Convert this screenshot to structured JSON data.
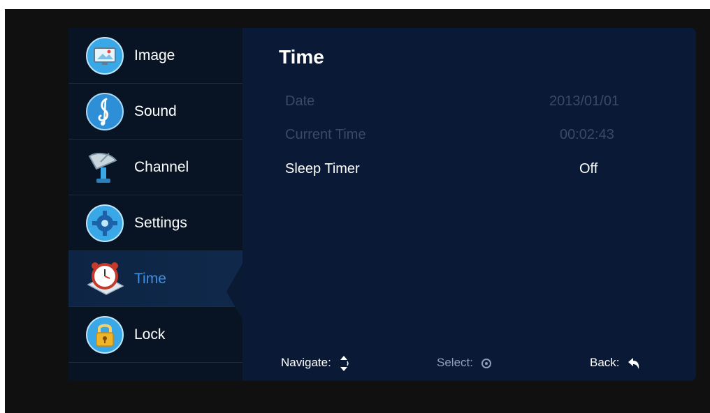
{
  "sidebar": {
    "items": [
      {
        "label": "Image",
        "icon": "image-icon"
      },
      {
        "label": "Sound",
        "icon": "music-note-icon"
      },
      {
        "label": "Channel",
        "icon": "satellite-dish-icon"
      },
      {
        "label": "Settings",
        "icon": "gear-icon"
      },
      {
        "label": "Time",
        "icon": "alarm-clock-icon",
        "active": true
      },
      {
        "label": "Lock",
        "icon": "padlock-icon"
      }
    ]
  },
  "main": {
    "title": "Time",
    "rows": [
      {
        "label": "Date",
        "value": "2013/01/01",
        "enabled": false
      },
      {
        "label": "Current Time",
        "value": "00:02:43",
        "enabled": false
      },
      {
        "label": "Sleep Timer",
        "value": "Off",
        "enabled": true
      }
    ]
  },
  "footer": {
    "navigate": "Navigate:",
    "select": "Select:",
    "back": "Back:"
  },
  "colors": {
    "active_label": "#3f8fe0",
    "panel_bg": "#0a1a36",
    "sidebar_bg": "#081423",
    "disabled_text": "#3a4a63"
  }
}
